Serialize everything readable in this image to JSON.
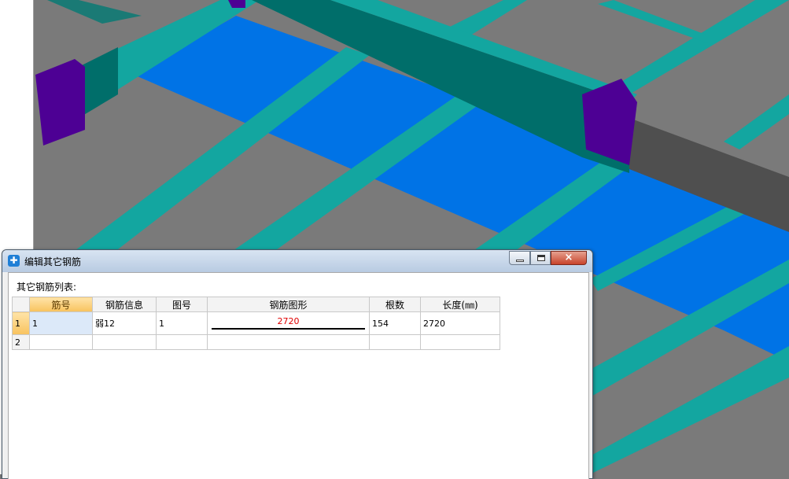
{
  "dialog": {
    "title": "编辑其它钢筋",
    "list_label": "其它钢筋列表:",
    "close_symbol": "×"
  },
  "table": {
    "columns": [
      "筋号",
      "钢筋信息",
      "图号",
      "钢筋图形",
      "根数",
      "长度(㎜)"
    ],
    "rows": [
      {
        "row_num": "1",
        "bar_no": "1",
        "bar_info": "弱12",
        "figure_no": "1",
        "shape_label": "2720",
        "count": "154",
        "length": "2720"
      },
      {
        "row_num": "2",
        "bar_no": "",
        "bar_info": "",
        "figure_no": "",
        "shape_label": "",
        "count": "",
        "length": ""
      }
    ]
  },
  "colors": {
    "slab_blue": "#0073e6",
    "beam_teal": "#13a6a0",
    "beam_dark": "#006e6a",
    "column_purple": "#4d0094",
    "ground_gray": "#7a7a7a",
    "shape_label_red": "#e00000"
  }
}
